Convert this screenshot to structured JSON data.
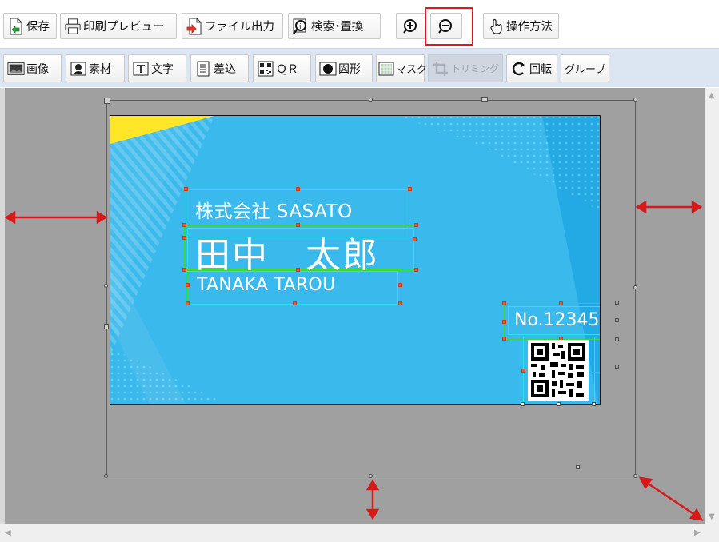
{
  "toolbar_main": {
    "save": "保存",
    "print_preview": "印刷プレビュー",
    "file_output": "ファイル出力",
    "search_replace": "検索･置換",
    "help": "操作方法"
  },
  "toolbar_insert": {
    "image": "画像",
    "material": "素材",
    "text": "文字",
    "merge": "差込",
    "qr": "ＱＲ",
    "shape": "図形",
    "mask": "マスク",
    "trimming": "トリミング",
    "rotate": "回転",
    "group": "グループ"
  },
  "card": {
    "company": "株式会社 SASATO",
    "name": "田中　太郎",
    "name_roman": "TANAKA TAROU",
    "number": "No.12345"
  },
  "colors": {
    "card_bg": "#3ab9ec",
    "annotation_red": "#e0161e",
    "selection_cyan": "#27e3ee",
    "selection_green": "#3dd63d",
    "handle_orange": "#f0552c",
    "workspace_gray": "#a0a0a0",
    "accent_yellow": "#ffe51a"
  }
}
